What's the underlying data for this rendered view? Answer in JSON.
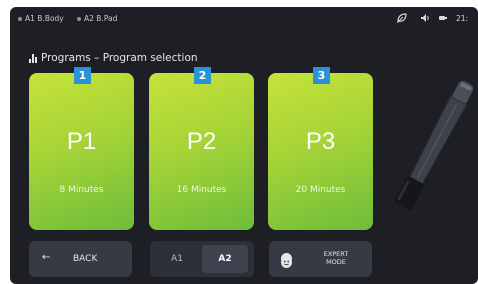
{
  "statusbar": {
    "items": [
      "A1 B.Body",
      "A2 B.Pad"
    ],
    "time": "21:"
  },
  "title": "Programs  –  Program selection",
  "programs": [
    {
      "badge": "1",
      "name": "P1",
      "duration": "8 Minutes"
    },
    {
      "badge": "2",
      "name": "P2",
      "duration": "16 Minutes"
    },
    {
      "badge": "3",
      "name": "P3",
      "duration": "20 Minutes"
    }
  ],
  "buttons": {
    "back": "BACK",
    "back_icon": "arrow-left-icon",
    "seg_a1": "A1",
    "seg_a2": "A2",
    "expert_line1": "EXPERT",
    "expert_line2": "MODE"
  },
  "colors": {
    "card_top": "#c6e23b",
    "card_bottom": "#6dbd3a",
    "badge": "#2a93d8",
    "background": "#1e1f25"
  }
}
